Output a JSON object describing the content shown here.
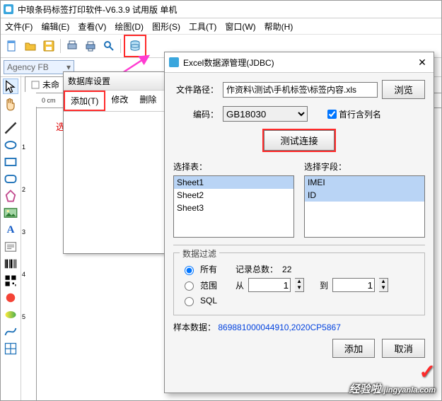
{
  "app": {
    "title": "中琅条码标签打印软件-V6.3.9 试用版 单机"
  },
  "menu": {
    "file": "文件(F)",
    "edit": "编辑(E)",
    "view": "查看(V)",
    "draw": "绘图(D)",
    "shape": "图形(S)",
    "tool": "工具(T)",
    "window": "窗口(W)",
    "help": "帮助(H)"
  },
  "font_combo": {
    "value": "Agency FB"
  },
  "doc": {
    "tab": "未命",
    "ruler0": "0 cm",
    "rv1": "1",
    "rv2": "2",
    "rv3": "3",
    "rv4": "4",
    "rv5": "5"
  },
  "tip": {
    "text": "选择 Excel数据源"
  },
  "dsbox": {
    "title": "数据库设置",
    "add": "添加(T)",
    "mod": "修改",
    "del": "删除"
  },
  "dlg": {
    "title": "Excel数据源管理(JDBC)",
    "lbl_path": "文件路径：",
    "path": "作资料\\测试\\手机标签\\标签内容.xls",
    "browse": "浏览",
    "lbl_enc": "编码：",
    "encoding": "GB18030",
    "firstrow": "首行含列名",
    "test": "测试连接",
    "lbl_table": "选择表：",
    "lbl_field": "选择字段：",
    "tables": [
      "Sheet1",
      "Sheet2",
      "Sheet3"
    ],
    "fields": [
      "IMEI",
      "ID"
    ],
    "filter": "数据过滤",
    "r_all": "所有",
    "count_lbl": "记录总数：",
    "count": "22",
    "r_range": "范围",
    "from_lbl": "从",
    "to_lbl": "到",
    "from": "1",
    "to": "1",
    "r_sql": "SQL",
    "sample_lbl": "样本数据：",
    "sample": "869881000044910,2020CP5867",
    "ok": "添加",
    "cancel": "取消"
  },
  "wm": {
    "site": "jingyanla.com",
    "brand": "经验啦"
  }
}
